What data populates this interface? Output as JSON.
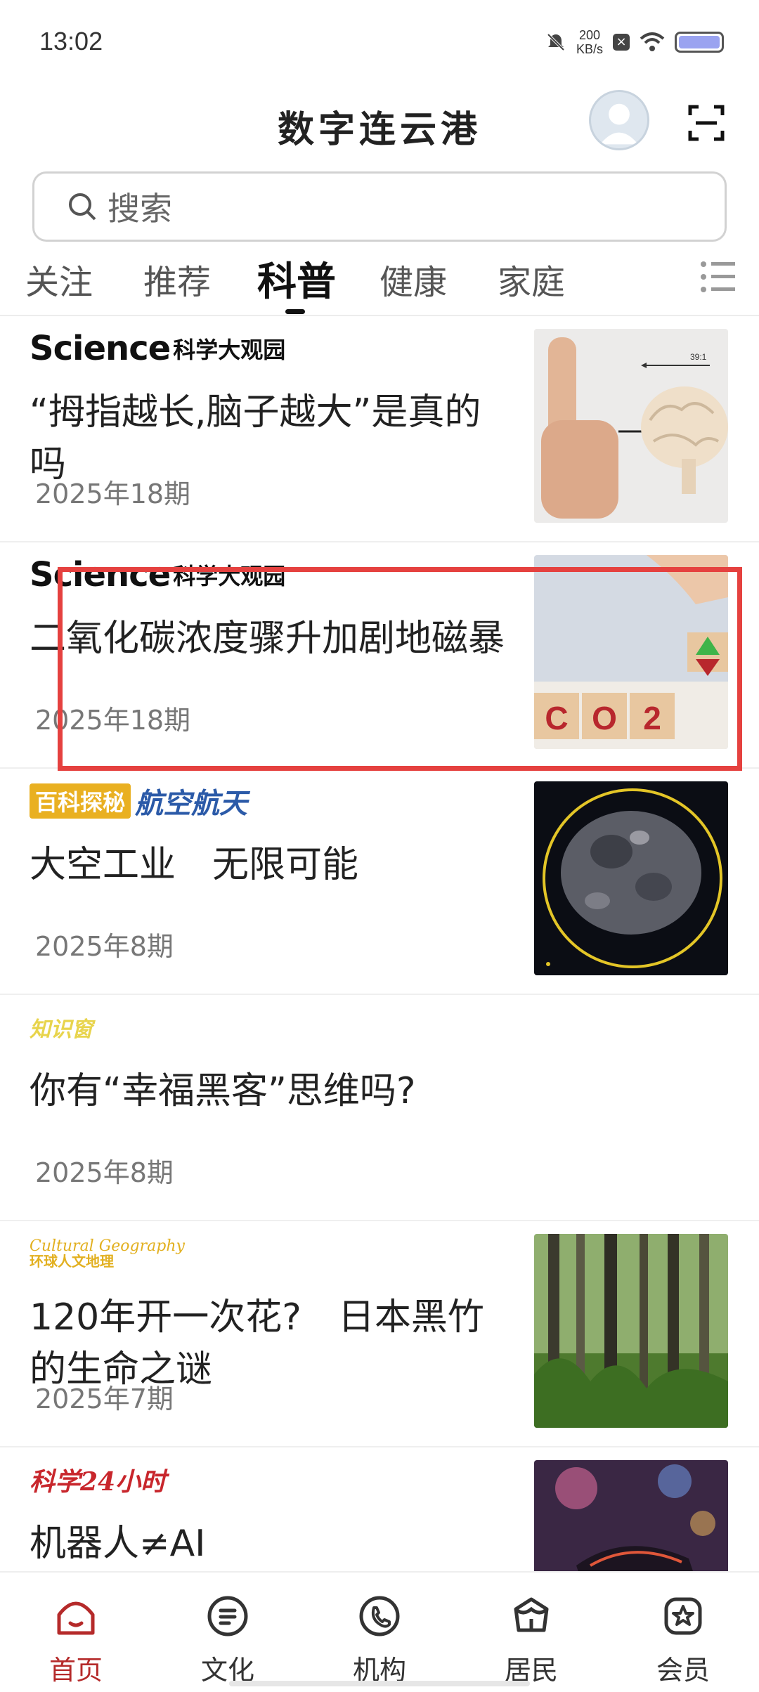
{
  "status_bar": {
    "time": "13:02",
    "speed_value": "200",
    "speed_unit": "KB/s",
    "battery_level": 1.0
  },
  "header": {
    "title": "数字连云港"
  },
  "search": {
    "placeholder": "搜索"
  },
  "tabs": [
    {
      "label": "关注"
    },
    {
      "label": "推荐"
    },
    {
      "label": "科普",
      "active": true
    },
    {
      "label": "健康"
    },
    {
      "label": "家庭"
    }
  ],
  "news": [
    {
      "source_en": "Science",
      "source_cn": "科学大观园",
      "title": "“拇指越长,脑子越大”是真的吗",
      "issue": "2025年18期",
      "thumb_text": "39:1"
    },
    {
      "source_en": "Science",
      "source_cn": "科学大观园",
      "title": "二氧化碳浓度骤升加剧地磁暴",
      "issue": "2025年18期",
      "thumb_text": [
        "C",
        "O",
        "2"
      ]
    },
    {
      "source_box": "百科探秘",
      "source_sub": "航空航天",
      "title": "大空工业　无限可能",
      "issue": "2025年8期"
    },
    {
      "source_cn": "知识窗",
      "title": "你有“幸福黑客”思维吗?",
      "issue": "2025年8期"
    },
    {
      "source_en": "Cultural Geography",
      "source_cn": "环球人文地理",
      "title": "120年开一次花?　日本黑竹的生命之谜",
      "issue": "2025年7期"
    },
    {
      "source_cn": "科学24小时",
      "title": "机器人≠AI"
    }
  ],
  "bottom_nav": [
    {
      "label": "首页",
      "active": true
    },
    {
      "label": "文化"
    },
    {
      "label": "机构"
    },
    {
      "label": "居民"
    },
    {
      "label": "会员"
    }
  ],
  "colors": {
    "accent": "#b52a2a",
    "highlight": "#e5413f"
  }
}
